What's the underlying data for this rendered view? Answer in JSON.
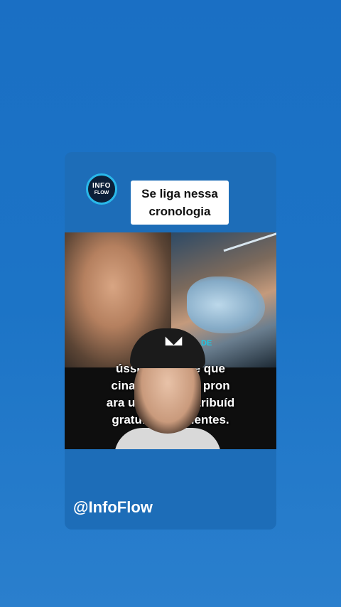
{
  "card": {
    "logo": {
      "line1": "INFO",
      "line2": "FLOW"
    },
    "title_line1": "Se liga nessa",
    "title_line2": "cronologia",
    "handle": "@InfoFlow"
  },
  "video": {
    "caption_lines": [
      "ússia ar        mente que",
      "cina cont          r está pron",
      "ara uso clí          á distribuíd",
      "gratuitam         pacientes."
    ],
    "cap_logo": "◣◢",
    "glove_text": "DE"
  },
  "colors": {
    "background": "#1c74c6",
    "card": "#1d6db8",
    "logo_ring": "#29b8ea"
  }
}
